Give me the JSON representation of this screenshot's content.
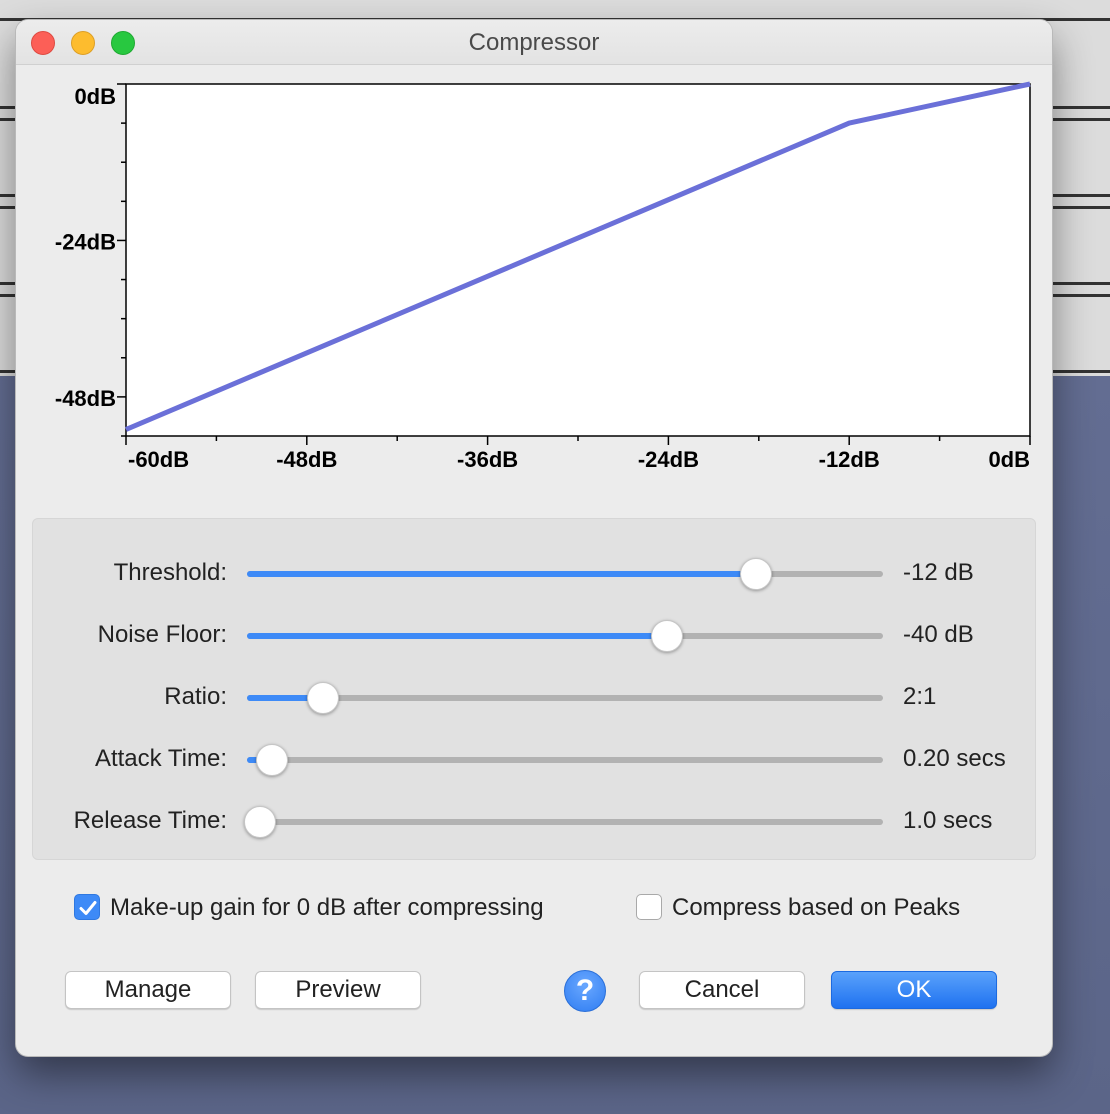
{
  "window": {
    "title": "Compressor"
  },
  "chart_data": {
    "type": "line",
    "x_ticks": [
      "-60dB",
      "-48dB",
      "-36dB",
      "-24dB",
      "-12dB",
      "0dB"
    ],
    "y_ticks": [
      "0dB",
      "-24dB",
      "-48dB"
    ],
    "xlim": [
      -60,
      0
    ],
    "ylim": [
      -54,
      0
    ],
    "series": [
      {
        "x": [
          -60,
          -12,
          0
        ],
        "y": [
          -53,
          -6,
          0
        ]
      }
    ],
    "line_color": "#6b70d8"
  },
  "sliders": [
    {
      "label": "Threshold:",
      "value": "-12 dB",
      "level": 0.8
    },
    {
      "label": "Noise Floor:",
      "value": "-40 dB",
      "level": 0.66
    },
    {
      "label": "Ratio:",
      "value": "2:1",
      "level": 0.12
    },
    {
      "label": "Attack Time:",
      "value": "0.20 secs",
      "level": 0.04
    },
    {
      "label": "Release Time:",
      "value": "1.0 secs",
      "level": 0.02
    }
  ],
  "checkboxes": [
    {
      "label": "Make-up gain for 0 dB after compressing",
      "checked": true
    },
    {
      "label": "Compress based on Peaks",
      "checked": false
    }
  ],
  "buttons": {
    "manage": "Manage",
    "preview": "Preview",
    "help": "?",
    "cancel": "Cancel",
    "ok": "OK"
  },
  "colors": {
    "accent": "#3d8af7",
    "curve": "#6b70d8"
  }
}
